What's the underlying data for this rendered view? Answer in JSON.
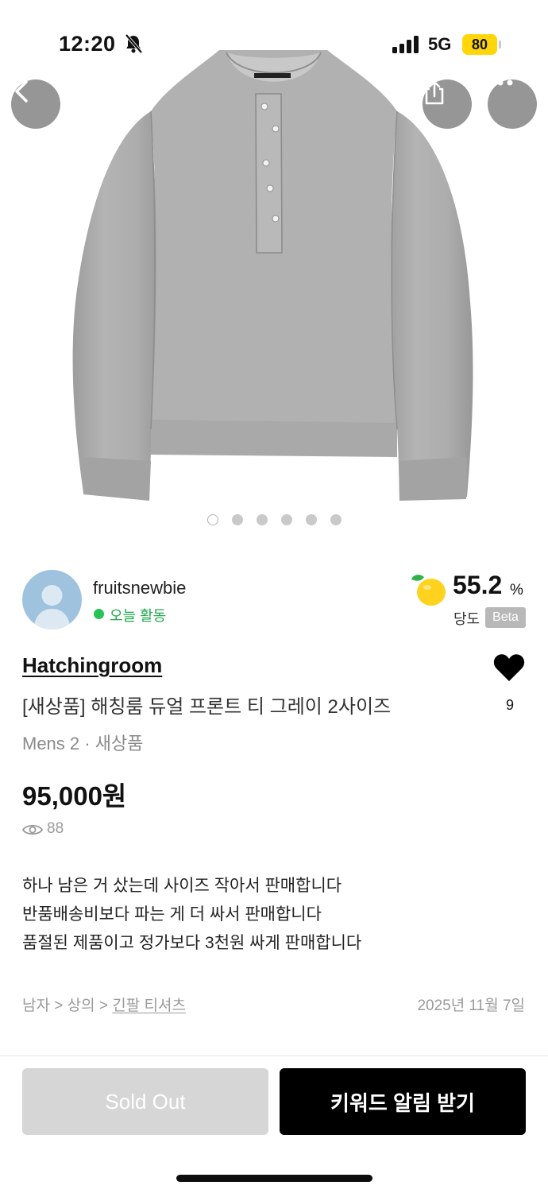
{
  "status_bar": {
    "time": "12:20",
    "network": "5G",
    "battery": "80",
    "icons": [
      "bell-slash-icon",
      "signal-icon"
    ]
  },
  "top_controls": {
    "back": "chevron-left-icon",
    "share": "share-icon",
    "more": "more-icon"
  },
  "gallery": {
    "image": "gray henley long-sleeve shirt photo",
    "total_images": 6,
    "active_index": 0
  },
  "seller": {
    "name": "fruitsnewbie",
    "activity": "오늘 활동",
    "sweetness_value": "55.2",
    "sweetness_unit": "%",
    "sweetness_label": "당도",
    "beta": "Beta",
    "sweetness_icon": "lemon-icon"
  },
  "product": {
    "brand": "Hatchingroom",
    "title": "[새상품] 해칭룸 듀얼 프론트 티 그레이 2사이즈",
    "meta": "Mens 2 · 새상품",
    "price": "95,000원",
    "likes": "9",
    "views": "88",
    "description": [
      "하나 남은 거 샀는데 사이즈 작아서 판매합니다",
      "반품배송비보다 파는 게 더 싸서 판매합니다",
      "품절된 제품이고 정가보다 3천원 싸게 판매합니다"
    ],
    "category": {
      "level1": "남자",
      "sep": " > ",
      "level2": "상의",
      "level3": "긴팔 티셔츠"
    },
    "date": "2025년 11월 7일"
  },
  "actions": {
    "sold_out": "Sold Out",
    "keyword_alert": "키워드 알림 받기"
  },
  "colors": {
    "online": "#26c455",
    "primary_button": "#000000",
    "disabled_button": "#d6d6d6",
    "battery": "#ffd60a"
  }
}
